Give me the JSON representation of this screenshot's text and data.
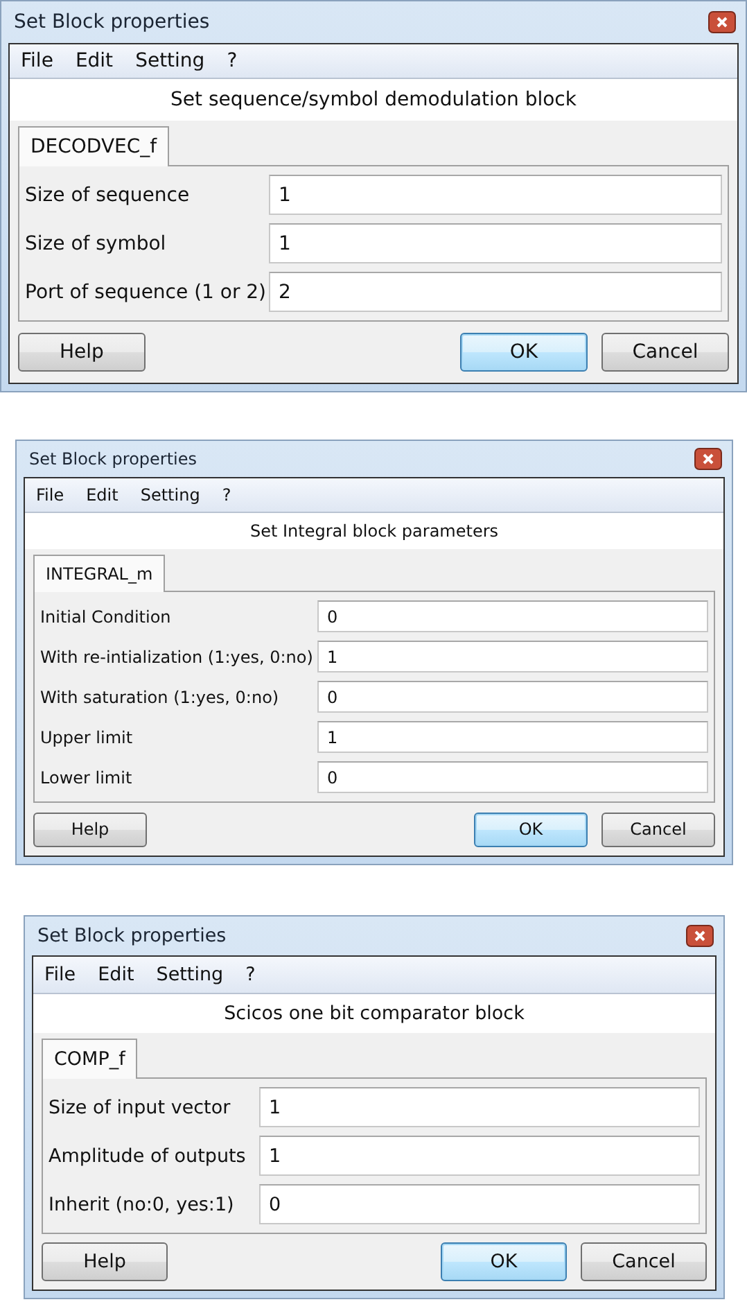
{
  "dialogs": [
    {
      "title": "Set Block properties",
      "menu": [
        "File",
        "Edit",
        "Setting",
        "?"
      ],
      "heading": "Set sequence/symbol demodulation block",
      "tabs": [
        {
          "label": "DECODVEC_f",
          "selected": true
        }
      ],
      "fields": [
        {
          "label": "Size of sequence",
          "value": "1"
        },
        {
          "label": "Size of symbol",
          "value": "1"
        },
        {
          "label": "Port of sequence (1 or 2)",
          "value": "2"
        }
      ],
      "buttons": [
        {
          "label": "Help",
          "default": false
        },
        {
          "label": "OK",
          "default": true
        },
        {
          "label": "Cancel",
          "default": false
        }
      ]
    },
    {
      "title": "Set Block properties",
      "menu": [
        "File",
        "Edit",
        "Setting",
        "?"
      ],
      "heading": "Set Integral block parameters",
      "tabs": [
        {
          "label": "INTEGRAL_m",
          "selected": true
        }
      ],
      "fields": [
        {
          "label": "Initial Condition",
          "value": "0"
        },
        {
          "label": "With re-intialization (1:yes, 0:no)",
          "value": "1"
        },
        {
          "label": "With saturation (1:yes, 0:no)",
          "value": "0"
        },
        {
          "label": "Upper limit",
          "value": "1"
        },
        {
          "label": "Lower limit",
          "value": "0"
        }
      ],
      "buttons": [
        {
          "label": "Help",
          "default": false
        },
        {
          "label": "OK",
          "default": true
        },
        {
          "label": "Cancel",
          "default": false
        }
      ]
    },
    {
      "title": "Set Block properties",
      "menu": [
        "File",
        "Edit",
        "Setting",
        "?"
      ],
      "heading": "Scicos one bit comparator block",
      "tabs": [
        {
          "label": "COMP_f",
          "selected": true
        }
      ],
      "fields": [
        {
          "label": "Size of input vector",
          "value": "1"
        },
        {
          "label": "Amplitude of outputs",
          "value": "1"
        },
        {
          "label": "Inherit (no:0, yes:1)",
          "value": "0"
        }
      ],
      "buttons": [
        {
          "label": "Help",
          "default": false
        },
        {
          "label": "OK",
          "default": true
        },
        {
          "label": "Cancel",
          "default": false
        }
      ]
    }
  ]
}
